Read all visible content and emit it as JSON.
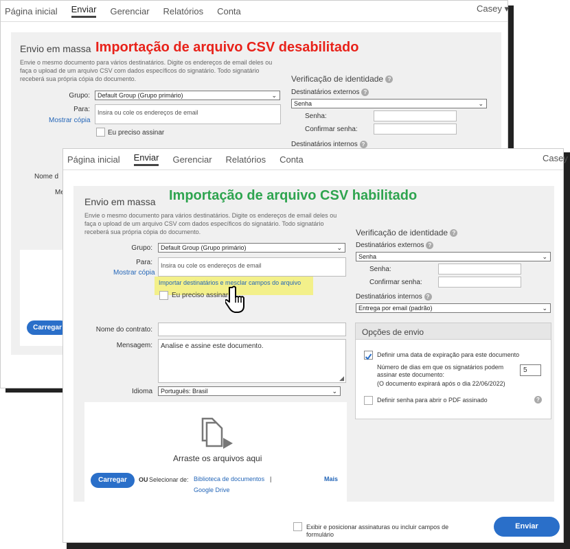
{
  "back": {
    "nav": {
      "home": "Página inicial",
      "send": "Enviar",
      "manage": "Gerenciar",
      "reports": "Relatórios",
      "account": "Conta",
      "user": "Casey"
    },
    "title": "Envio em massa",
    "banner": "Importação de arquivo CSV desabilitado",
    "desc": "Envie o mesmo documento para vários destinatários. Digite os endereços de email deles ou faça o upload de um arquivo CSV com dados específicos do signatário. Todo signatário receberá sua própria cópia do documento.",
    "group_label": "Grupo:",
    "group_value": "Default Group (Grupo primário)",
    "to_label": "Para:",
    "to_placeholder": "Insira ou cole os endereços de email",
    "show_copy": "Mostrar cópia",
    "self_sign": "Eu preciso assinar",
    "id_title": "Verificação de identidade",
    "ext": "Destinatários externos",
    "ext_value": "Senha",
    "pwd": "Senha:",
    "confirm": "Confirmar senha:",
    "int": "Destinatários internos",
    "name_partial": "Nome d",
    "msg_partial": "Me",
    "upload": "Carregar"
  },
  "front": {
    "nav": {
      "home": "Página inicial",
      "send": "Enviar",
      "manage": "Gerenciar",
      "reports": "Relatórios",
      "account": "Conta",
      "user": "Casey"
    },
    "title": "Envio em massa",
    "banner": "Importação de arquivo CSV habilitado",
    "desc": "Envie o mesmo documento para vários destinatários. Digite os endereços de email deles ou faça o upload de um arquivo CSV com dados específicos do signatário. Todo signatário receberá sua própria cópia do documento.",
    "group_label": "Grupo:",
    "group_value": "Default Group (Grupo primário)",
    "to_label": "Para:",
    "to_placeholder": "Insira ou cole os endereços de email",
    "show_copy": "Mostrar cópia",
    "import_link": "Importar destinatários e mesclar campos do arquivo",
    "self_sign": "Eu preciso assinar",
    "contract_label": "Nome do contrato:",
    "msg_label": "Mensagem:",
    "msg_value": "Analise e assine este documento.",
    "lang_label": "Idioma",
    "lang_value": "Português: Brasil",
    "drop_text": "Arraste os arquivos aqui",
    "upload": "Carregar",
    "or": "OU",
    "select_from": "Selecionar de:",
    "library": "Biblioteca de documentos",
    "sep": "|",
    "gdrive": "Google Drive",
    "more": "Mais",
    "id_title": "Verificação de identidade",
    "ext": "Destinatários externos",
    "ext_value": "Senha",
    "pwd": "Senha:",
    "confirm": "Confirmar senha:",
    "int": "Destinatários internos",
    "int_value": "Entrega por email (padrão)",
    "options_title": "Opções de envio",
    "opt_expire": "Definir uma data de expiração para este documento",
    "days_label": "Número de dias em que os signatários podem assinar este documento:",
    "days_value": "5",
    "expire_note": "(O documento expirará após o dia 22/06/2022)",
    "opt_pwd": "Definir senha para abrir o PDF assinado",
    "place_fields": "Exibir e posicionar assinaturas ou incluir campos de formulário",
    "send": "Enviar"
  },
  "colors": {
    "red": "#e8221a",
    "green": "#2ea44f",
    "blue": "#2a6fc9",
    "highlight": "#f3f08a"
  }
}
